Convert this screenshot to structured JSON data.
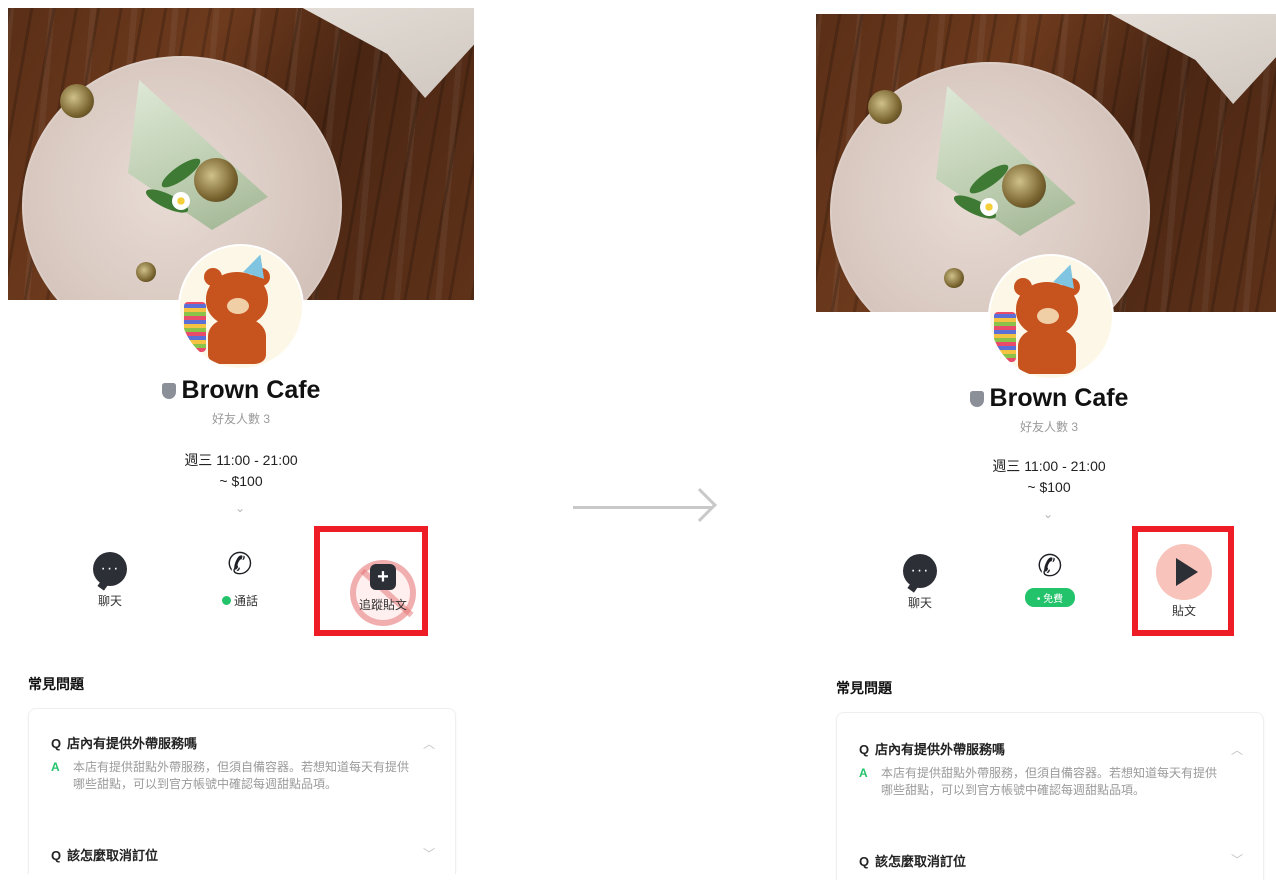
{
  "before": {
    "name": "Brown Cafe",
    "friends": "好友人數 3",
    "hours_line1": "週三 11:00 - 21:00",
    "hours_line2": "~ $100",
    "actions": {
      "chat": "聊天",
      "call": "通話",
      "follow": "追蹤貼文"
    },
    "faq": {
      "title": "常見問題",
      "q1": "店內有提供外帶服務嗎",
      "a1": "本店有提供甜點外帶服務，但須自備容器。若想知道每天有提供哪些甜點，可以到官方帳號中確認每週甜點品項。",
      "q2": "該怎麼取消訂位",
      "q_mark": "Q",
      "a_mark": "A"
    }
  },
  "after": {
    "name": "Brown Cafe",
    "friends": "好友人數 3",
    "hours_line1": "週三 11:00 - 21:00",
    "hours_line2": "~ $100",
    "actions": {
      "chat": "聊天",
      "call_badge": "• 免費",
      "posts": "貼文"
    },
    "faq": {
      "title": "常見問題",
      "q1": "店內有提供外帶服務嗎",
      "a1": "本店有提供甜點外帶服務，但須自備容器。若想知道每天有提供哪些甜點，可以到官方帳號中確認每週甜點品項。",
      "q2": "該怎麼取消訂位",
      "q_mark": "Q",
      "a_mark": "A"
    }
  },
  "colors": {
    "highlight": "#ee1c25",
    "line_green": "#23c36b",
    "arrow": "#c9c9c9"
  },
  "icons": [
    "chat-bubble-icon",
    "phone-icon",
    "plus-icon",
    "no-entry-icon",
    "play-icon",
    "shield-icon",
    "right-arrow-icon"
  ]
}
